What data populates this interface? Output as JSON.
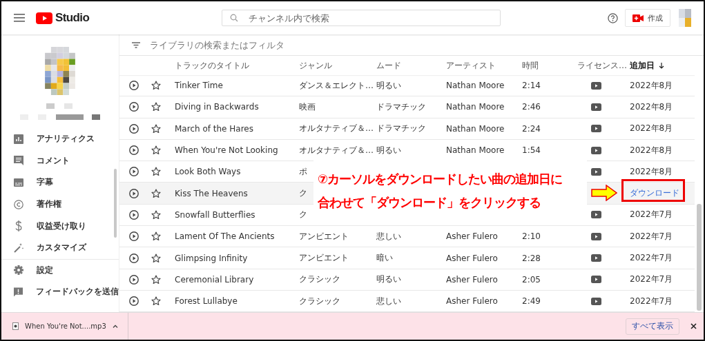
{
  "header": {
    "logo_text": "Studio",
    "search_placeholder": "チャンネル内で検索",
    "create_label": "作成"
  },
  "sidebar": {
    "items": [
      {
        "kind": "analytics",
        "label": "アナリティクス"
      },
      {
        "kind": "comment",
        "label": "コメント"
      },
      {
        "kind": "subtitles",
        "label": "字幕"
      },
      {
        "kind": "copyright",
        "label": "著作権"
      },
      {
        "kind": "money",
        "label": "収益受け取り"
      },
      {
        "kind": "wand",
        "label": "カスタマイズ"
      }
    ],
    "bottom_items": [
      {
        "kind": "settings",
        "label": "設定"
      },
      {
        "kind": "feedback",
        "label": "フィードバックを送信"
      }
    ]
  },
  "filter": {
    "placeholder": "ライブラリの検索またはフィルタ"
  },
  "table": {
    "columns": [
      "トラックのタイトル",
      "ジャンル",
      "ムード",
      "アーティスト",
      "時間",
      "ライセンス…",
      "追加日"
    ],
    "rows": [
      {
        "title": "Tinker Time",
        "genre": "ダンス＆エレクト…",
        "mood": "明るい",
        "artist": "Nathan Moore",
        "duration": "2:14",
        "added": "2022年8月",
        "hovered": false
      },
      {
        "title": "Diving in Backwards",
        "genre": "映画",
        "mood": "ドラマチック",
        "artist": "Nathan Moore",
        "duration": "2:46",
        "added": "2022年8月",
        "hovered": false
      },
      {
        "title": "March of the Hares",
        "genre": "オルタナティブ＆…",
        "mood": "ドラマチック",
        "artist": "Nathan Moore",
        "duration": "2:24",
        "added": "2022年8月",
        "hovered": false
      },
      {
        "title": "When You're Not Looking",
        "genre": "オルタナティブ＆…",
        "mood": "明るい",
        "artist": "Nathan Moore",
        "duration": "1:54",
        "added": "2022年8月",
        "hovered": false
      },
      {
        "title": "Look Both Ways",
        "genre": "ポ",
        "added": "2022年8月",
        "hovered": false
      },
      {
        "title": "Kiss The Heavens",
        "genre": "ク",
        "added": "ダウンロード",
        "hovered": true
      },
      {
        "title": "Snowfall Butterflies",
        "genre": "ク",
        "added": "2022年7月",
        "hovered": false
      },
      {
        "title": "Lament Of The Ancients",
        "genre": "アンビエント",
        "mood": "悲しい",
        "artist": "Asher Fulero",
        "duration": "2:10",
        "added": "2022年7月",
        "hovered": false
      },
      {
        "title": "Glimpsing Infinity",
        "genre": "アンビエント",
        "mood": "暗い",
        "artist": "Asher Fulero",
        "duration": "2:28",
        "added": "2022年7月",
        "hovered": false
      },
      {
        "title": "Ceremonial Library",
        "genre": "クラシック",
        "mood": "明るい",
        "artist": "Asher Fulero",
        "duration": "2:05",
        "added": "2022年7月",
        "hovered": false
      },
      {
        "title": "Forest Lullabye",
        "genre": "クラシック",
        "mood": "悲しい",
        "artist": "Asher Fulero",
        "duration": "2:49",
        "added": "2022年7月",
        "hovered": false
      }
    ]
  },
  "callout": {
    "lines": [
      "⑦カーソルをダウンロードしたい曲の追加日に",
      "合わせて「ダウンロード」をクリックする"
    ]
  },
  "download_bar": {
    "file_name": "When You're Not....mp3",
    "show_all_label": "すべて表示"
  }
}
